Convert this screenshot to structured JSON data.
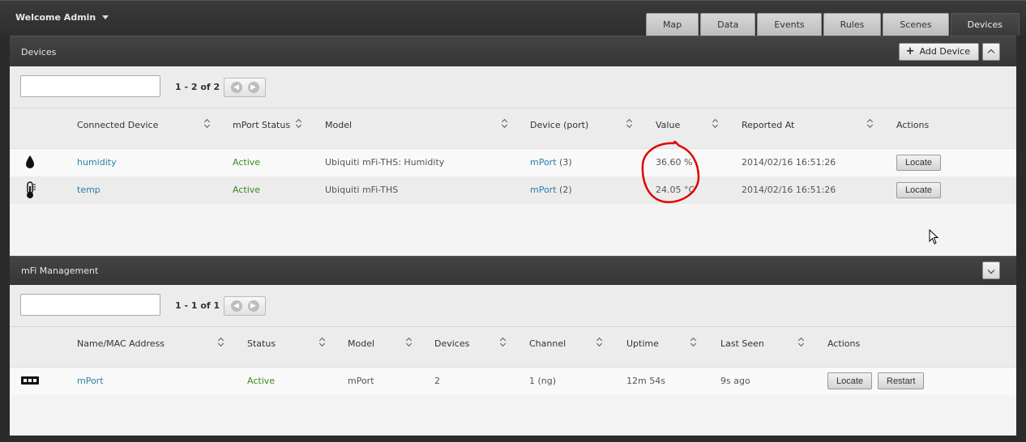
{
  "header": {
    "welcome": "Welcome Admin",
    "tabs": [
      {
        "label": "Map",
        "active": false
      },
      {
        "label": "Data",
        "active": false
      },
      {
        "label": "Events",
        "active": false
      },
      {
        "label": "Rules",
        "active": false
      },
      {
        "label": "Scenes",
        "active": false
      },
      {
        "label": "Devices",
        "active": true
      }
    ]
  },
  "devices_panel": {
    "title": "Devices",
    "add_button": "Add Device",
    "search_value": "",
    "pager": "1 - 2 of 2",
    "columns": [
      "Connected Device",
      "mPort Status",
      "Model",
      "Device (port)",
      "Value",
      "Reported At",
      "Actions"
    ],
    "rows": [
      {
        "icon": "water-drop-icon",
        "name": "humidity",
        "status": "Active",
        "model": "Ubiquiti mFi-THS: Humidity",
        "port_link": "mPort",
        "port_num": "(3)",
        "value": "36.60 %",
        "reported": "2014/02/16 16:51:26",
        "action": "Locate"
      },
      {
        "icon": "thermometer-icon",
        "name": "temp",
        "status": "Active",
        "model": "Ubiquiti mFi-THS",
        "port_link": "mPort",
        "port_num": "(2)",
        "value": "24.05 °C",
        "reported": "2014/02/16 16:51:26",
        "action": "Locate"
      }
    ]
  },
  "mfi_panel": {
    "title": "mFi Management",
    "search_value": "",
    "pager": "1 - 1 of 1",
    "columns": [
      "Name/MAC Address",
      "Status",
      "Model",
      "Devices",
      "Channel",
      "Uptime",
      "Last Seen",
      "Actions"
    ],
    "rows": [
      {
        "icon": "mport-device-icon",
        "name": "mPort",
        "status": "Active",
        "model": "mPort",
        "devices": "2",
        "channel": "1 (ng)",
        "uptime": "12m 54s",
        "last_seen": "9s ago",
        "action1": "Locate",
        "action2": "Restart"
      }
    ]
  },
  "colors": {
    "accent_link": "#2a7fa8",
    "active_status": "#3a8a1e",
    "annotation": "#e00000"
  }
}
